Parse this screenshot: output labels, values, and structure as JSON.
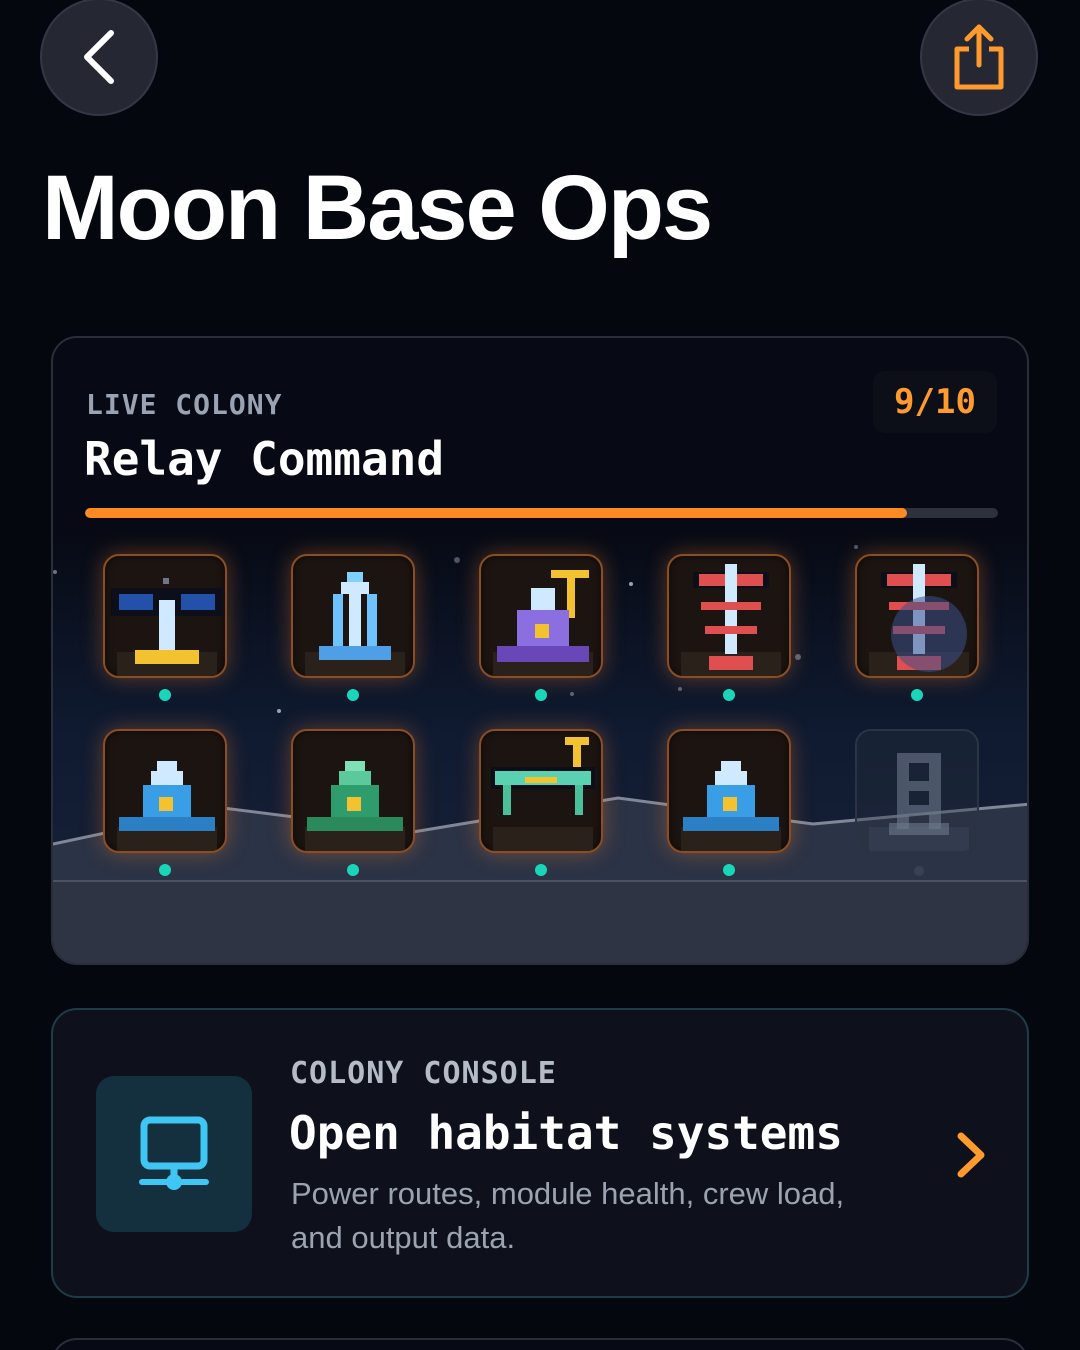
{
  "header": {
    "back_icon": "chevron-left-icon",
    "share_icon": "share-icon",
    "title": "Moon Base Ops",
    "accent_color": "#ff9a2e"
  },
  "colony_card": {
    "kicker": "LIVE COLONY",
    "name": "Relay Command",
    "count_label": "9/10",
    "progress": 0.9,
    "modules": [
      {
        "icon": "solar-array-icon",
        "status": "online"
      },
      {
        "icon": "antenna-tower-icon",
        "status": "online"
      },
      {
        "icon": "dome-lab-icon",
        "status": "online"
      },
      {
        "icon": "relay-mast-icon",
        "status": "online"
      },
      {
        "icon": "relay-mast-icon",
        "status": "online"
      },
      {
        "icon": "habitat-pod-icon",
        "status": "online"
      },
      {
        "icon": "greenhouse-pod-icon",
        "status": "online"
      },
      {
        "icon": "rover-bay-icon",
        "status": "online"
      },
      {
        "icon": "habitat-pod-icon",
        "status": "online"
      },
      {
        "icon": "locked-tower-icon",
        "status": "locked"
      }
    ]
  },
  "console_card": {
    "icon": "monitor-network-icon",
    "kicker": "COLONY CONSOLE",
    "title": "Open habitat systems",
    "description": "Power routes, module health, crew load, and output data.",
    "chevron_icon": "chevron-right-icon",
    "icon_color": "#3fc6f2"
  }
}
